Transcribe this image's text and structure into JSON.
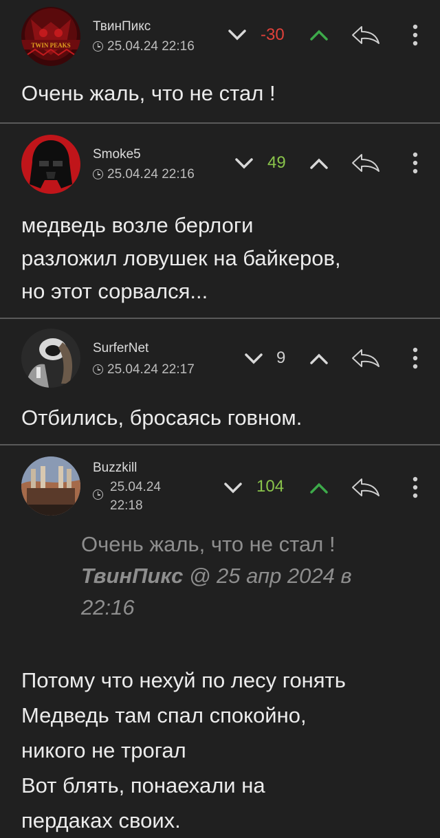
{
  "colors": {
    "negative": "#e0413a",
    "positive": "#8ac44b",
    "neutral": "#cfcfcf",
    "up_arrow_green": "#3daa4a"
  },
  "comments": [
    {
      "author": "ТвинПикс",
      "avatar_icon": "twin-peaks-owl-avatar",
      "avatar_text": "TWIN PEAKS",
      "date": "25.04.24 22:16",
      "score": "-30",
      "text": "Очень жаль, что не стал !"
    },
    {
      "author": "Smoke5",
      "avatar_icon": "red-vader-avatar",
      "date": "25.04.24 22:16",
      "score": "49",
      "text": "медведь возле берлоги\nразложил ловушек на байкеров,\nно этот сорвался..."
    },
    {
      "author": "SurferNet",
      "avatar_icon": "mono-portrait-avatar",
      "date": "25.04.24 22:17",
      "score": "9",
      "text": "Отбились, бросаясь говном."
    },
    {
      "author": "Buzzkill",
      "avatar_icon": "factory-chimneys-avatar",
      "date_line1": "25.04.24",
      "date_line2": "22:18",
      "score": "104",
      "quote": {
        "text": "Очень жаль, что не стал !",
        "author": "ТвинПикс",
        "meta": "@ 25 апр 2024 в",
        "time": "22:16"
      },
      "text": "Потому что нехуй по лесу гонять\nМедведь там спал спокойно,\nникого не трогал\nВот блять, понаехали на\nпердаках своих."
    }
  ]
}
